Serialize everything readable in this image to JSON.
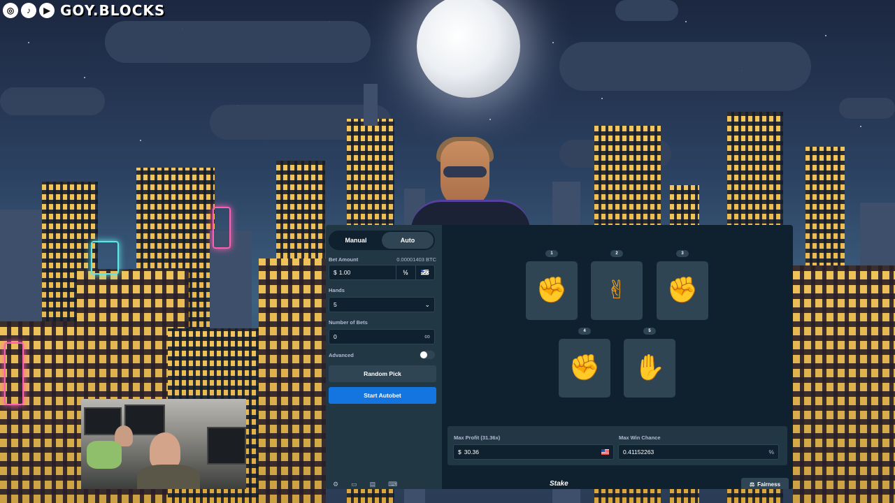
{
  "overlay": {
    "social_icons": [
      "instagram-icon",
      "tiktok-icon",
      "youtube-icon"
    ],
    "brand": "GOY.BLOCKS"
  },
  "sidebar": {
    "tabs": [
      {
        "label": "Manual",
        "active": false
      },
      {
        "label": "Auto",
        "active": true
      }
    ],
    "bet_amount": {
      "label": "Bet Amount",
      "btc_value": "0.00001403 BTC",
      "currency_symbol": "$",
      "value": "1.00",
      "half_label": "½",
      "double_label": "2×"
    },
    "hands": {
      "label": "Hands",
      "value": "5"
    },
    "number_of_bets": {
      "label": "Number of Bets",
      "value": "0",
      "infinity": "∞"
    },
    "advanced": {
      "label": "Advanced",
      "enabled": false
    },
    "random_pick_label": "Random Pick",
    "start_autobet_label": "Start Autobet"
  },
  "board": {
    "hands": [
      {
        "number": "1",
        "type": "rock",
        "glyph": "✊"
      },
      {
        "number": "2",
        "type": "scissors",
        "glyph": "✌"
      },
      {
        "number": "3",
        "type": "rock",
        "glyph": "✊"
      },
      {
        "number": "4",
        "type": "rock",
        "glyph": "✊"
      },
      {
        "number": "5",
        "type": "paper",
        "glyph": "✋"
      }
    ],
    "max_profit": {
      "label": "Max Profit (31.36x)",
      "currency_symbol": "$",
      "value": "30.36"
    },
    "max_win_chance": {
      "label": "Max Win Chance",
      "value": "0.41152263",
      "unit": "%"
    },
    "brand_logo": "Stake",
    "fairness_label": "Fairness"
  },
  "colors": {
    "panel_bg": "#0f212e",
    "sidebar_bg": "#213743",
    "control_bg": "#2f4553",
    "primary_blue": "#1475e1",
    "hand_orange": "#f6a623"
  }
}
